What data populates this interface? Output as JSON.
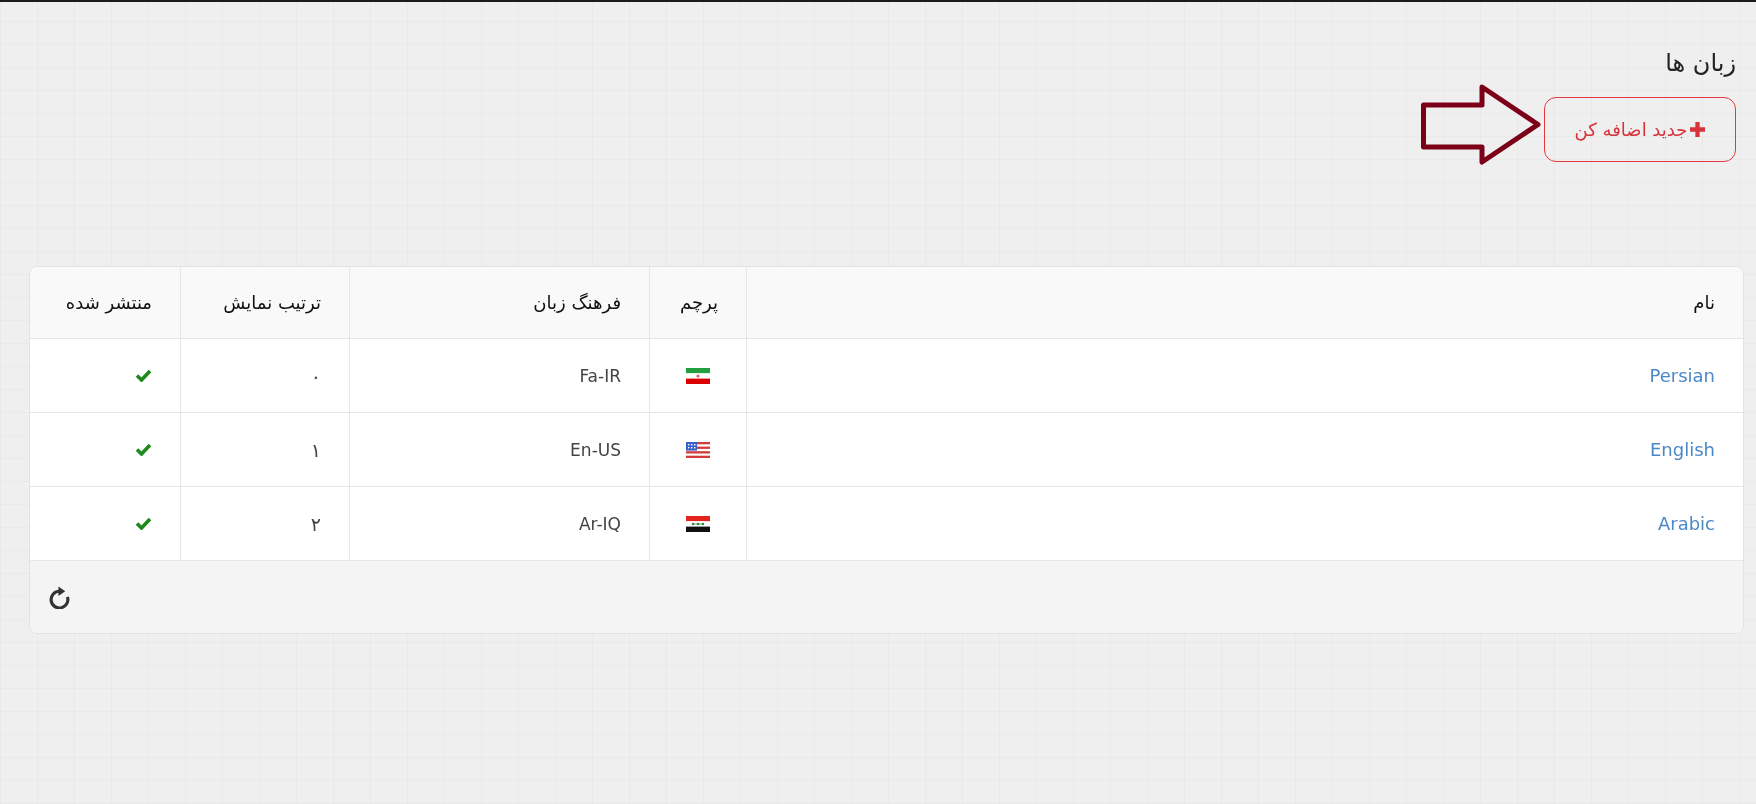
{
  "page": {
    "title": "زبان ها"
  },
  "add_button": {
    "label": "جدید اضافه کن"
  },
  "table": {
    "columns": [
      "نام",
      "پرچم",
      "فرهنگ زبان",
      "ترتیب نمایش",
      "منتشر شده"
    ],
    "rows": [
      {
        "name": "Persian",
        "flag": {
          "kind": "iran"
        },
        "culture": "Fa-IR",
        "order": "۰",
        "published": true
      },
      {
        "name": "English",
        "flag": {
          "kind": "usa"
        },
        "culture": "En-US",
        "order": "۱",
        "published": true
      },
      {
        "name": "Arabic",
        "flag": {
          "kind": "iraq"
        },
        "culture": "Ar-IQ",
        "order": "۲",
        "published": true
      }
    ]
  }
}
